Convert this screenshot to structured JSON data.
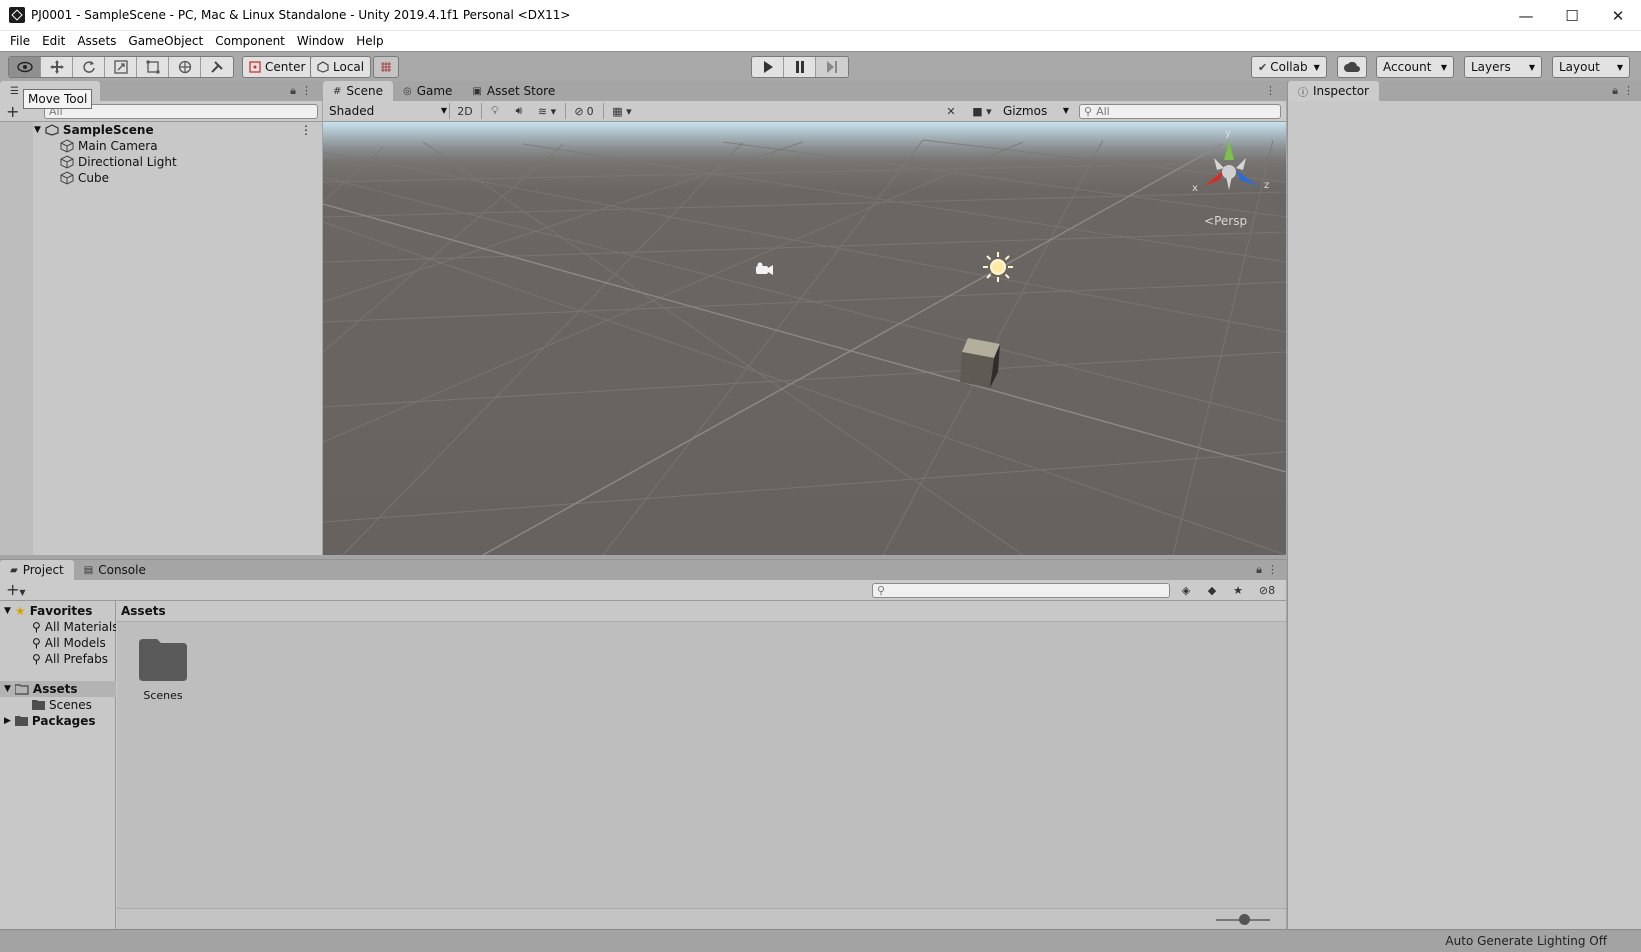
{
  "window": {
    "title": "PJ0001 - SampleScene - PC, Mac & Linux Standalone - Unity 2019.4.1f1 Personal <DX11>",
    "minimize": "—",
    "maximize": "☐",
    "close": "✕"
  },
  "menu": [
    "File",
    "Edit",
    "Assets",
    "GameObject",
    "Component",
    "Window",
    "Help"
  ],
  "toolbar": {
    "tooltip": "Move Tool",
    "pivot_label": "Center",
    "space_label": "Local",
    "collab_label": "Collab",
    "account_label": "Account",
    "layers_label": "Layers",
    "layout_label": "Layout"
  },
  "hierarchy": {
    "search_placeholder": "All",
    "scene_name": "SampleScene",
    "objects": [
      "Main Camera",
      "Directional Light",
      "Cube"
    ]
  },
  "scene_tabs": {
    "scene": "Scene",
    "game": "Game",
    "asset_store": "Asset Store"
  },
  "scene_toolbar": {
    "shading_mode": "Shaded",
    "mode_2d": "2D",
    "hidden_count": "0",
    "gizmos_label": "Gizmos",
    "search_placeholder": "All"
  },
  "scene_view": {
    "projection_label": "Persp",
    "axis_x": "x",
    "axis_y": "y",
    "axis_z": "z"
  },
  "inspector": {
    "title": "Inspector"
  },
  "bottom_tabs": {
    "project": "Project",
    "console": "Console"
  },
  "project": {
    "hidden_count": "8",
    "favorites_label": "Favorites",
    "favorites": [
      "All Materials",
      "All Models",
      "All Prefabs"
    ],
    "assets_label": "Assets",
    "assets_children": [
      "Scenes"
    ],
    "packages_label": "Packages",
    "breadcrumb": "Assets",
    "items": [
      "Scenes"
    ]
  },
  "status": {
    "lighting": "Auto Generate Lighting Off"
  },
  "colors": {
    "panel_bg": "#c8c8c8",
    "toolbar_bg": "#a9a9a9",
    "scene_ground": "#666260",
    "gizmo_x": "#d0302a",
    "gizmo_y": "#7ac04a",
    "gizmo_z": "#2f6bd8"
  }
}
